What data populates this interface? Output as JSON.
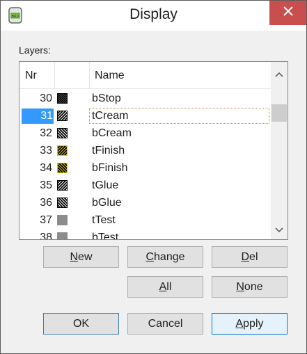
{
  "window": {
    "title": "Display",
    "app_icon": "brd-document-icon",
    "close_icon": "close-icon"
  },
  "layers_label": "Layers:",
  "list": {
    "columns": [
      "Nr",
      "",
      "Name"
    ],
    "rows": [
      {
        "nr": "30",
        "name": "bStop",
        "pattern": "hatch-fine-dark",
        "color": "#000000",
        "selected": false
      },
      {
        "nr": "31",
        "name": "tCream",
        "pattern": "hatch-diagonal",
        "color": "#000000",
        "selected": true
      },
      {
        "nr": "32",
        "name": "bCream",
        "pattern": "hatch-backslash",
        "color": "#000000",
        "selected": false
      },
      {
        "nr": "33",
        "name": "tFinish",
        "pattern": "hatch-diagonal-yellow",
        "color": "#d4c200",
        "selected": false
      },
      {
        "nr": "34",
        "name": "bFinish",
        "pattern": "hatch-backslash-yellow",
        "color": "#d4c200",
        "selected": false
      },
      {
        "nr": "35",
        "name": "tGlue",
        "pattern": "hatch-diagonal",
        "color": "#000000",
        "selected": false
      },
      {
        "nr": "36",
        "name": "bGlue",
        "pattern": "hatch-backslash",
        "color": "#000000",
        "selected": false
      },
      {
        "nr": "37",
        "name": "tTest",
        "pattern": "solid-gray",
        "color": "#8c8c8c",
        "selected": false
      },
      {
        "nr": "38",
        "name": "bTest",
        "pattern": "solid-gray",
        "color": "#8c8c8c",
        "selected": false
      }
    ]
  },
  "buttons": {
    "new": {
      "first": "N",
      "rest": "ew"
    },
    "change": {
      "first": "C",
      "rest": "hange"
    },
    "del": {
      "first": "D",
      "rest": "el"
    },
    "all": {
      "first": "A",
      "rest": "ll"
    },
    "none": {
      "first": "N",
      "rest": "one"
    },
    "ok": "OK",
    "cancel": "Cancel",
    "apply": {
      "first": "A",
      "rest": "pply"
    }
  },
  "colors": {
    "selection": "#3399ff",
    "close_button": "#c94f4f"
  }
}
